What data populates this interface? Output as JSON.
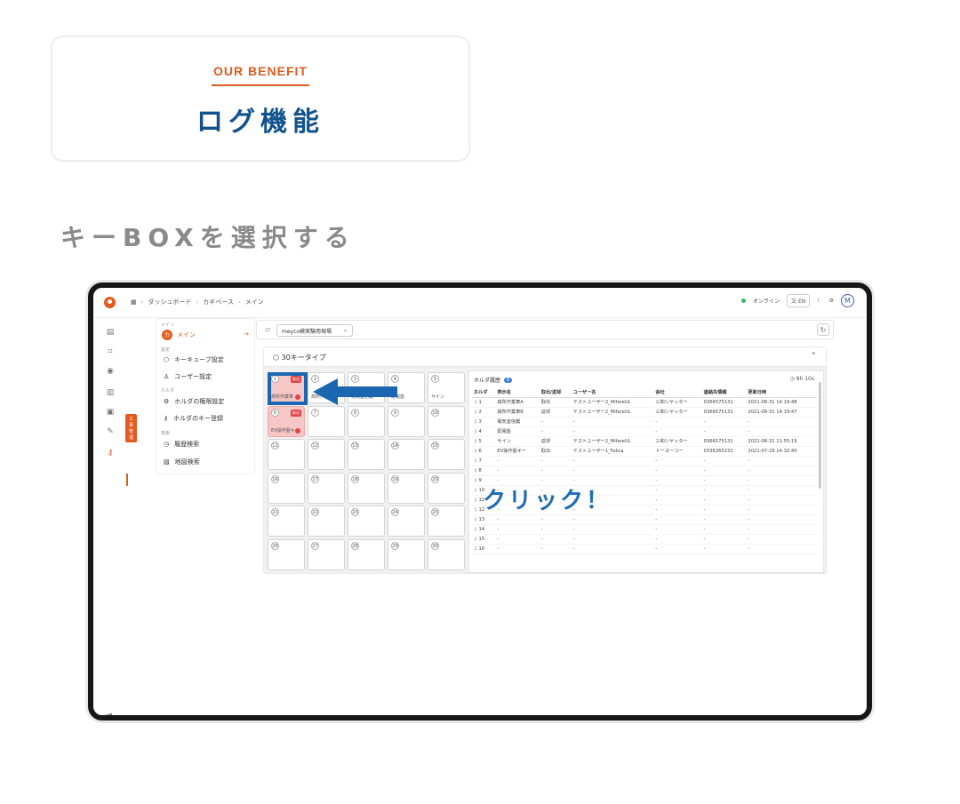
{
  "benefit": {
    "kicker": "OUR BENEFIT",
    "title": "ログ機能"
  },
  "step_heading": "キーBOXを選択する",
  "app": {
    "breadcrumbs": [
      "ダッシュボード",
      "カギベース",
      "メイン"
    ],
    "status_online": "オンライン",
    "lang": "EN",
    "avatar_initial": "M",
    "rail_tooltip": "工事管理",
    "menu": {
      "main_section": "メイン",
      "main_item": "メイン",
      "main_badge": "カ",
      "settings_section": "設定",
      "key_cube_settings": "キーキューブ設定",
      "user_settings": "ユーザー設定",
      "holder_section": "ホルダ",
      "holder_permission": "ホルダの権限設定",
      "holder_key_register": "ホルダのキー登録",
      "search_section": "検索",
      "history_search": "履歴検索",
      "map_search": "地図検索"
    },
    "site_select": "meyco検実験用現場",
    "panel_title": "30キータイプ",
    "click_label": "クリック！",
    "history": {
      "title": "ホルダ履歴",
      "count": "6",
      "timer": "8h 10s",
      "columns": [
        "ホルダ",
        "表示名",
        "取出/返却",
        "ユーザー名",
        "会社",
        "連絡先情報",
        "更新日時"
      ],
      "rows": [
        {
          "no": "1",
          "name": "高所作業車A",
          "status": "取出",
          "state": "out",
          "user": "テストユーザー2_MifareUL",
          "company": "三和シヤッター",
          "contact": "0366575131",
          "updated": "2021-08-31 14:19:48"
        },
        {
          "no": "2",
          "name": "高所作業車B",
          "status": "返却",
          "state": "in",
          "user": "テストユーザー2_MifareUL",
          "company": "三和シヤッター",
          "contact": "0366575131",
          "updated": "2021-08-31 14:19:47"
        },
        {
          "no": "3",
          "name": "電気室信鍵",
          "status": "-",
          "state": "none",
          "user": "-",
          "company": "-",
          "contact": "-",
          "updated": "-"
        },
        {
          "no": "4",
          "name": "配電盤",
          "status": "-",
          "state": "none",
          "user": "-",
          "company": "-",
          "contact": "-",
          "updated": "-"
        },
        {
          "no": "5",
          "name": "サイン",
          "status": "返却",
          "state": "in",
          "user": "テストユーザー2_MifareUL",
          "company": "三和シヤッター",
          "contact": "0366575131",
          "updated": "2021-08-31 11:55:19"
        },
        {
          "no": "6",
          "name": "EV操作盤キー",
          "status": "取出",
          "state": "out",
          "user": "テストユーザー1_Felica",
          "company": "トーヨーコー",
          "contact": "0336265231",
          "updated": "2021-07-29 14:32:40"
        },
        {
          "no": "7",
          "name": "-",
          "status": "-",
          "state": "none",
          "user": "-",
          "company": "-",
          "contact": "-",
          "updated": "-"
        },
        {
          "no": "8",
          "name": "-",
          "status": "-",
          "state": "none",
          "user": "-",
          "company": "-",
          "contact": "-",
          "updated": "-"
        },
        {
          "no": "9",
          "name": "-",
          "status": "-",
          "state": "none",
          "user": "-",
          "company": "-",
          "contact": "-",
          "updated": "-"
        },
        {
          "no": "10",
          "name": "-",
          "status": "-",
          "state": "none",
          "user": "-",
          "company": "-",
          "contact": "-",
          "updated": "-"
        },
        {
          "no": "11",
          "name": "-",
          "status": "-",
          "state": "none",
          "user": "-",
          "company": "-",
          "contact": "-",
          "updated": "-"
        },
        {
          "no": "12",
          "name": "-",
          "status": "-",
          "state": "none",
          "user": "-",
          "company": "-",
          "contact": "-",
          "updated": "-"
        },
        {
          "no": "13",
          "name": "-",
          "status": "-",
          "state": "none",
          "user": "-",
          "company": "-",
          "contact": "-",
          "updated": "-"
        },
        {
          "no": "14",
          "name": "-",
          "status": "-",
          "state": "none",
          "user": "-",
          "company": "-",
          "contact": "-",
          "updated": "-"
        },
        {
          "no": "15",
          "name": "-",
          "status": "-",
          "state": "none",
          "user": "-",
          "company": "-",
          "contact": "-",
          "updated": "-"
        },
        {
          "no": "16",
          "name": "-",
          "status": "-",
          "state": "none",
          "user": "-",
          "company": "-",
          "contact": "-",
          "updated": "-"
        }
      ]
    },
    "slots": [
      {
        "num": "1",
        "label": "高所作業車",
        "taken": true,
        "tag": "取出",
        "alert": true
      },
      {
        "num": "2",
        "label": "高所作業車B",
        "taken": false
      },
      {
        "num": "3",
        "label": "電気室信鍵",
        "taken": false
      },
      {
        "num": "4",
        "label": "配電盤",
        "taken": false
      },
      {
        "num": "5",
        "label": "サイン",
        "taken": false
      },
      {
        "num": "6",
        "label": "EV操作盤キ",
        "taken": true,
        "tag": "取出",
        "alert": true
      },
      {
        "num": "7",
        "label": "",
        "taken": false
      },
      {
        "num": "8",
        "label": "",
        "taken": false
      },
      {
        "num": "9",
        "label": "",
        "taken": false
      },
      {
        "num": "10",
        "label": "",
        "taken": false
      },
      {
        "num": "11",
        "label": "",
        "taken": false
      },
      {
        "num": "12",
        "label": "",
        "taken": false
      },
      {
        "num": "13",
        "label": "",
        "taken": false
      },
      {
        "num": "14",
        "label": "",
        "taken": false
      },
      {
        "num": "15",
        "label": "",
        "taken": false
      },
      {
        "num": "16",
        "label": "",
        "taken": false
      },
      {
        "num": "17",
        "label": "",
        "taken": false
      },
      {
        "num": "18",
        "label": "",
        "taken": false
      },
      {
        "num": "19",
        "label": "",
        "taken": false
      },
      {
        "num": "20",
        "label": "",
        "taken": false
      },
      {
        "num": "21",
        "label": "",
        "taken": false
      },
      {
        "num": "22",
        "label": "",
        "taken": false
      },
      {
        "num": "23",
        "label": "",
        "taken": false
      },
      {
        "num": "24",
        "label": "",
        "taken": false
      },
      {
        "num": "25",
        "label": "",
        "taken": false
      },
      {
        "num": "26",
        "label": "",
        "taken": false
      },
      {
        "num": "27",
        "label": "",
        "taken": false
      },
      {
        "num": "28",
        "label": "",
        "taken": false
      },
      {
        "num": "29",
        "label": "",
        "taken": false
      },
      {
        "num": "30",
        "label": "",
        "taken": false
      }
    ],
    "colors": {
      "accent": "#e15a1f",
      "title_blue": "#12538f",
      "highlight_blue": "#1b66b0",
      "taken": "#f7c6c6",
      "out": "#e04545",
      "in": "#3a7fd6"
    }
  }
}
